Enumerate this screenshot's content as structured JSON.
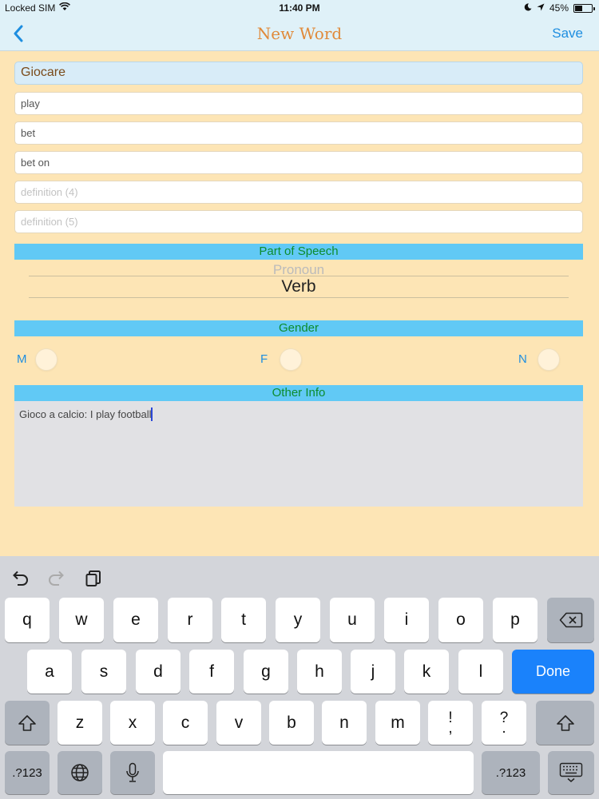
{
  "status_bar": {
    "carrier": "Locked SIM",
    "time": "11:40 PM",
    "battery": "45%",
    "battery_level": 0.45
  },
  "nav": {
    "title": "New Word",
    "save_label": "Save"
  },
  "word": {
    "value": "Giocare",
    "definitions": [
      "play",
      "bet",
      "bet on"
    ],
    "placeholders": [
      "definition (4)",
      "definition (5)"
    ]
  },
  "part_of_speech": {
    "header": "Part of Speech",
    "previous_option": "Pronoun",
    "selected": "Verb"
  },
  "gender": {
    "header": "Gender",
    "options": [
      "M",
      "F",
      "N"
    ]
  },
  "other_info": {
    "header": "Other Info",
    "text": "Gioco a calcio: I play football"
  },
  "keyboard": {
    "row1": [
      "q",
      "w",
      "e",
      "r",
      "t",
      "y",
      "u",
      "i",
      "o",
      "p"
    ],
    "row2": [
      "a",
      "s",
      "d",
      "f",
      "g",
      "h",
      "j",
      "k",
      "l"
    ],
    "row3": [
      "z",
      "x",
      "c",
      "v",
      "b",
      "n",
      "m"
    ],
    "punct1_top": "!",
    "punct1_bottom": ",",
    "punct2_top": "?",
    "punct2_bottom": ".",
    "done_label": "Done",
    "numbers_label": ".?123"
  }
}
